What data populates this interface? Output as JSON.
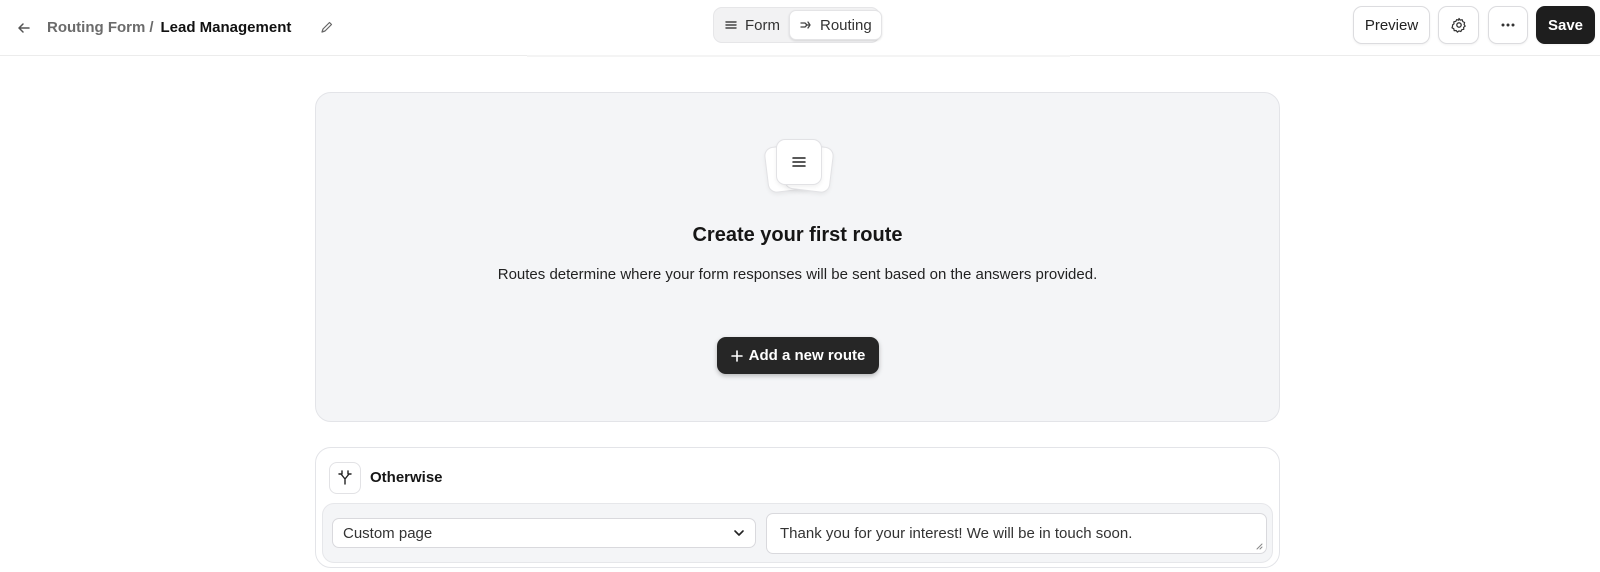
{
  "header": {
    "breadcrumb_parent": "Routing Form",
    "breadcrumb_separator": "/",
    "breadcrumb_current": "Lead Management",
    "tabs": [
      {
        "label": "Form",
        "icon": "list-icon",
        "active": false
      },
      {
        "label": "Routing",
        "icon": "routing-icon",
        "active": true
      }
    ],
    "preview_label": "Preview",
    "save_label": "Save"
  },
  "empty_state": {
    "title": "Create your first route",
    "description": "Routes determine where your form responses will be sent based on the answers provided.",
    "add_button_label": "Add a new route"
  },
  "otherwise": {
    "label": "Otherwise",
    "select_value": "Custom page",
    "message": "Thank you for your interest! We will be in touch soon."
  },
  "colors": {
    "primary_button": "#1e1e1e",
    "card_background": "#f4f5f7"
  }
}
